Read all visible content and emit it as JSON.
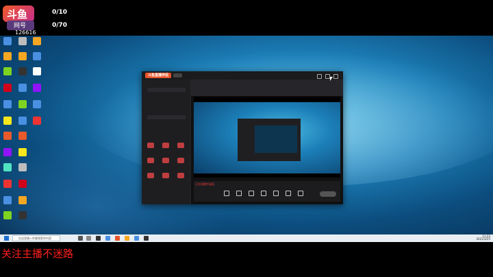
{
  "overlay": {
    "logo_text": "斗鱼",
    "logo_sub": "网号",
    "room_id": "126616",
    "counter1": "0/10",
    "counter2": "0/70",
    "follow_text": "关注主播不迷路"
  },
  "taskbar": {
    "search_placeholder": "在这里输入你要搜索的内容",
    "time": "11:23",
    "date": "2021/3/25"
  },
  "app": {
    "title_logo": "斗鱼直播伴侣",
    "live_label": "正在直播中画面"
  },
  "colors": {
    "overlay_red": "#ff1f1f",
    "brand_orange": "#e8542a",
    "desktop_blue": "#1c7fb8"
  }
}
